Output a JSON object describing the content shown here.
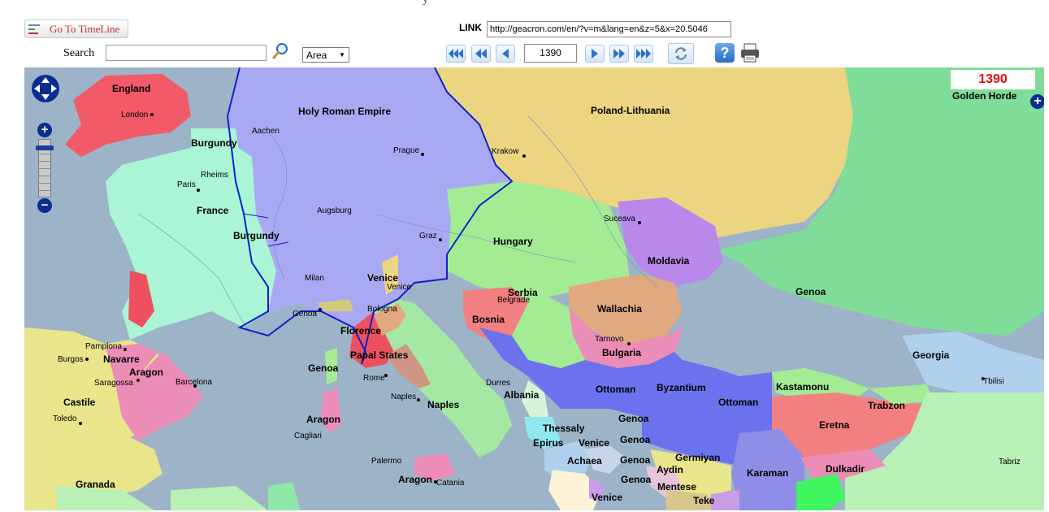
{
  "toolbar": {
    "timeline_label": "Go To TimeLine",
    "search_label": "Search",
    "search_value": "",
    "area_option": "Area",
    "link_label": "LINK",
    "link_value": "http://geacron.com/en/?v=m&lang=en&z=5&x=20.5046",
    "year_value": "1390"
  },
  "map": {
    "year": "1390",
    "corner_region": "Golden Horde",
    "regions": [
      "England",
      "Holy Roman Empire",
      "Poland-Lithuania",
      "Burgundy",
      "France",
      "Burgundy",
      "Hungary",
      "Moldavia",
      "Genoa",
      "Venice",
      "Serbia",
      "Wallachia",
      "Bosnia",
      "Florence",
      "Papal States",
      "Bulgaria",
      "Georgia",
      "Kastamonu",
      "Byzantium",
      "Ottoman",
      "Ottoman",
      "Trabzon",
      "Eretna",
      "Albania",
      "Naples",
      "Navarre",
      "Aragon",
      "Castile",
      "Aragon",
      "Genoa",
      "Thessaly",
      "Epirus",
      "Venice",
      "Genoa",
      "Genoa",
      "Germiyan",
      "Achaea",
      "Aydin",
      "Karaman",
      "Dulkadir",
      "Genoa",
      "Mentese",
      "Aragon",
      "Granada",
      "Venice",
      "Teke",
      "Genoa"
    ],
    "cities": [
      "London",
      "Aachen",
      "Rheims",
      "Paris",
      "Prague",
      "Krakow",
      "Augsburg",
      "Suceava",
      "Graz",
      "Milan",
      "Venice",
      "Genoa",
      "Bologna",
      "Belgrade",
      "Tarnovo",
      "Tbilisi",
      "Pamplona",
      "Burgos",
      "Saragossa",
      "Barcelona",
      "Toledo",
      "Rome",
      "Naples",
      "Durres",
      "Cagliari",
      "Palermo",
      "Catania",
      "Tabriz"
    ]
  },
  "colors": {
    "sea": "#9db3c8",
    "holy_roman_empire": "#a9a9f3",
    "poland_lithuania": "#ecd581",
    "golden_horde": "#80dd99",
    "france": "#a9f5d5",
    "hungary": "#a4ec93",
    "moldavia": "#b889ea",
    "ottoman": "#6c72ee",
    "england": "#f35a68",
    "year_text": "#e01010",
    "border_blue": "#1020c8"
  }
}
